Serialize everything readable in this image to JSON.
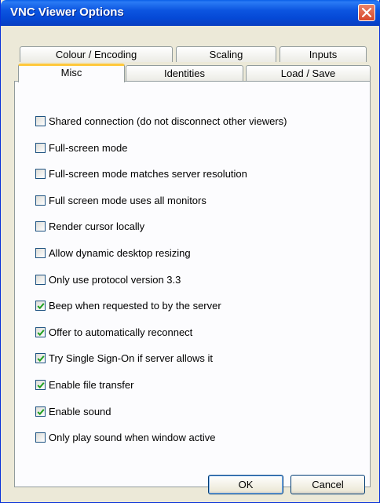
{
  "window": {
    "title": "VNC Viewer Options"
  },
  "tabs_back": [
    "Colour / Encoding",
    "Scaling",
    "Inputs"
  ],
  "tabs_front": [
    "Misc",
    "Identities",
    "Load / Save"
  ],
  "active_tab": "Misc",
  "options": [
    {
      "label": "Shared connection (do not disconnect other viewers)",
      "checked": false
    },
    {
      "label": "Full-screen mode",
      "checked": false
    },
    {
      "label": "Full-screen mode matches server resolution",
      "checked": false
    },
    {
      "label": "Full screen mode uses all monitors",
      "checked": false
    },
    {
      "label": "Render cursor locally",
      "checked": false
    },
    {
      "label": "Allow dynamic desktop resizing",
      "checked": false
    },
    {
      "label": "Only use protocol version 3.3",
      "checked": false
    },
    {
      "label": "Beep when requested to by the server",
      "checked": true
    },
    {
      "label": "Offer to automatically reconnect",
      "checked": true
    },
    {
      "label": "Try Single Sign-On if server allows it",
      "checked": true
    },
    {
      "label": "Enable file transfer",
      "checked": true
    },
    {
      "label": "Enable sound",
      "checked": true
    },
    {
      "label": "Only play sound when window active",
      "checked": false
    }
  ],
  "buttons": {
    "ok": "OK",
    "cancel": "Cancel"
  },
  "colors": {
    "titlebar": "#0549d6",
    "active_tab_accent": "#ffc83c",
    "check": "#21a121"
  },
  "icons": {
    "close": "close-icon",
    "checkmark": "checkmark-icon"
  }
}
